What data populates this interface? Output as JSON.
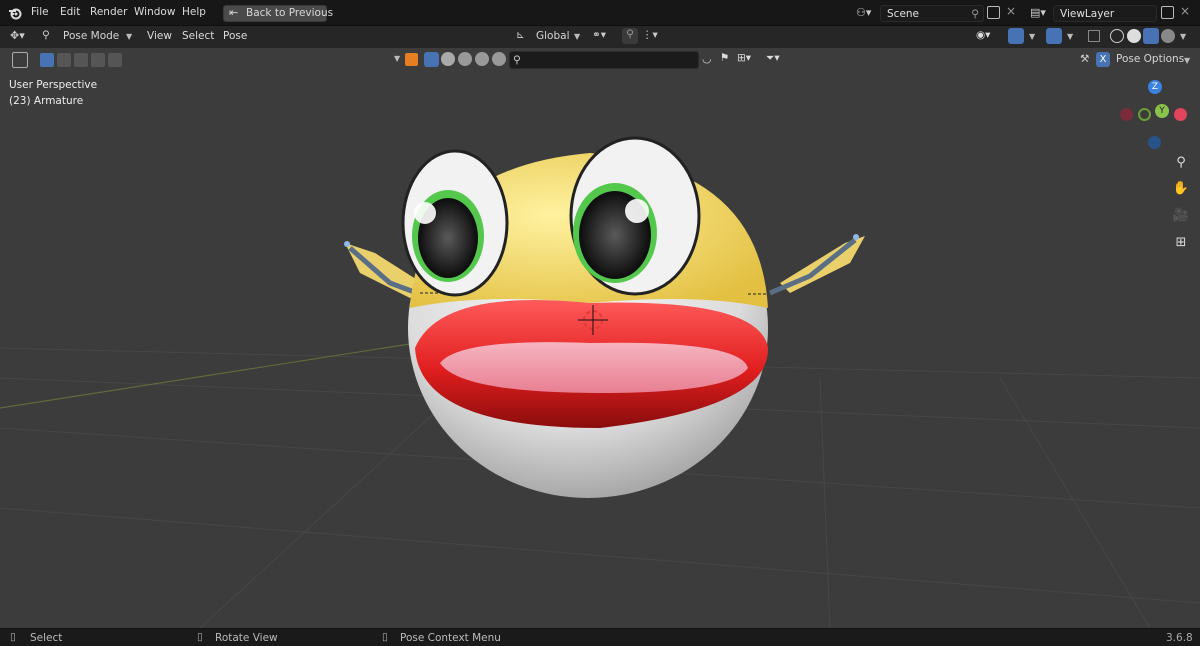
{
  "topbar": {
    "menus": [
      "File",
      "Edit",
      "Render",
      "Window",
      "Help"
    ],
    "back_button": "Back to Previous",
    "scene_field": "Scene",
    "viewlayer_field": "ViewLayer"
  },
  "header": {
    "mode": "Pose Mode",
    "menus": [
      "View",
      "Select",
      "Pose"
    ],
    "orientation": "Global",
    "pose_options": "Pose Options"
  },
  "search": {
    "placeholder": ""
  },
  "viewport": {
    "perspective": "User Perspective",
    "object": "(23) Armature",
    "gizmo_axes": [
      "Z",
      "Y"
    ]
  },
  "status": {
    "select": "Select",
    "rotate": "Rotate View",
    "context": "Pose Context Menu",
    "version": "3.6.8"
  },
  "colors": {
    "accent": "#4772b3",
    "viewport_bg": "#3c3c3c",
    "axis_x": "#e2435d",
    "axis_y": "#8bc34a",
    "axis_z": "#3b82e0"
  }
}
